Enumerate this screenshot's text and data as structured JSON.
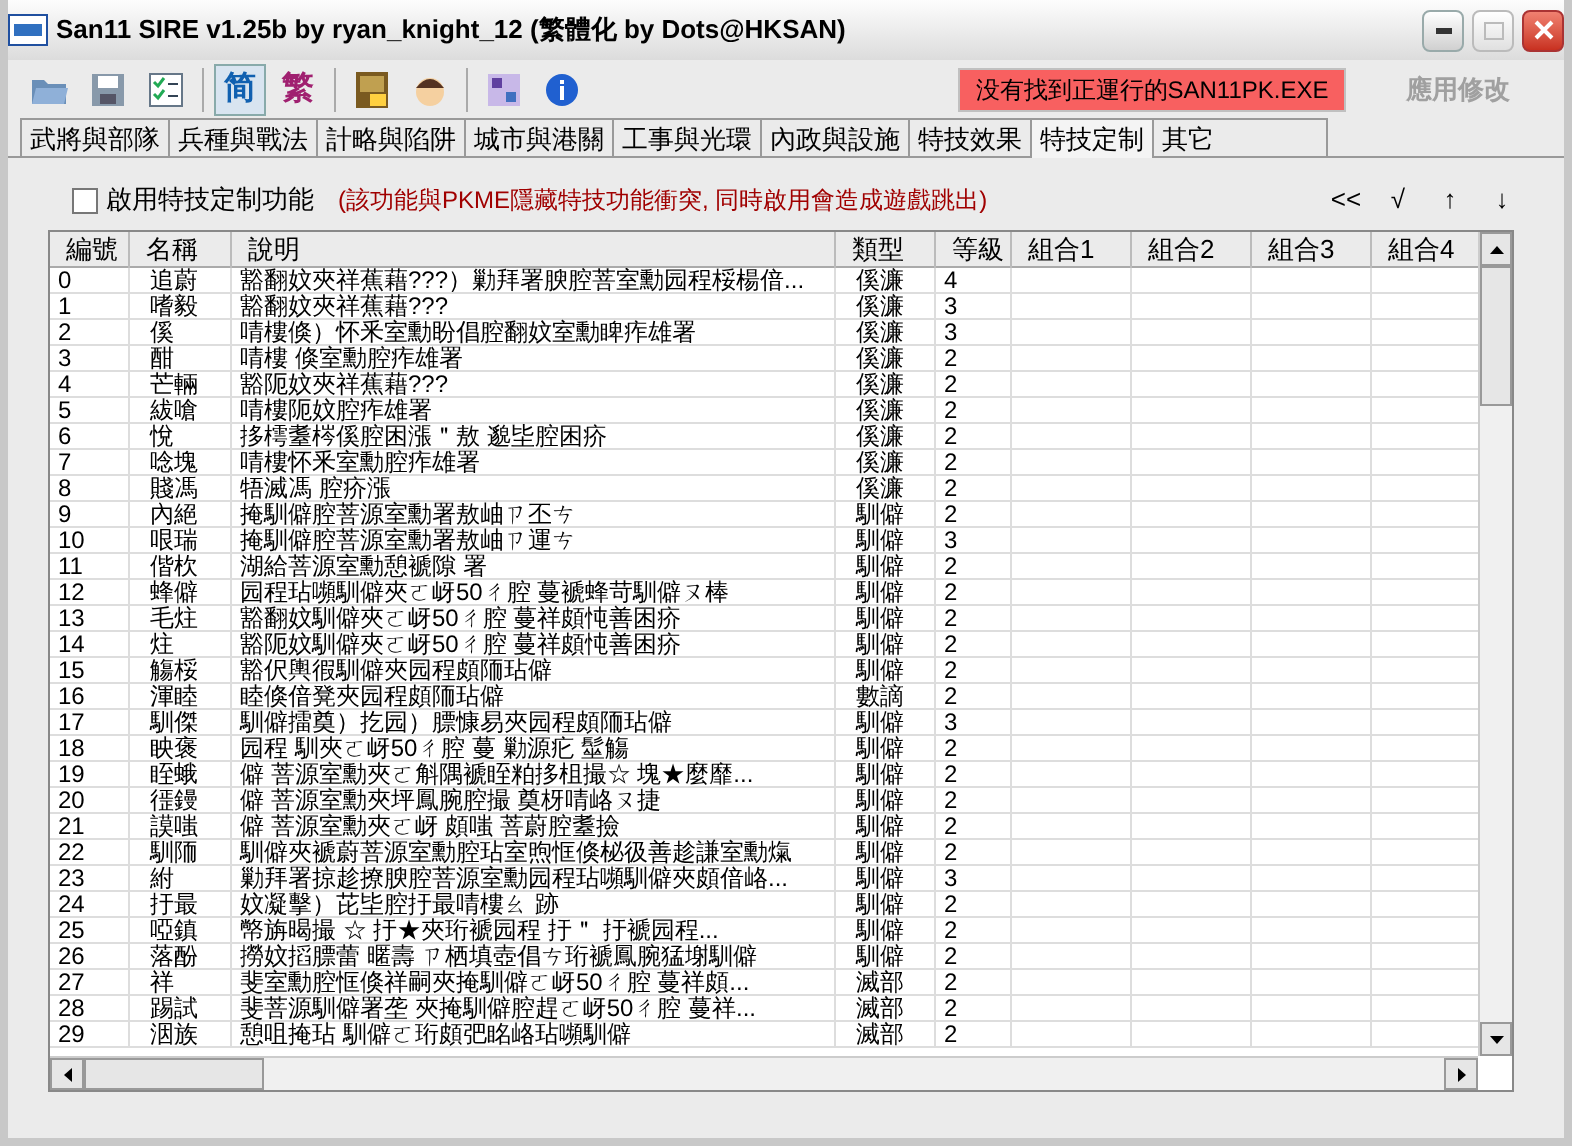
{
  "window": {
    "title": "San11 SIRE v1.25b by ryan_knight_12 (繁體化 by Dots@HKSAN)"
  },
  "toolbar": {
    "buttons": [
      {
        "kind": "open",
        "selected": false
      },
      {
        "kind": "save",
        "selected": false
      },
      {
        "kind": "checklist",
        "selected": false
      },
      {
        "kind": "text",
        "label": "简",
        "selected": true
      },
      {
        "kind": "text",
        "label": "繁",
        "selected": false
      },
      {
        "kind": "game",
        "selected": false
      },
      {
        "kind": "face",
        "selected": false
      },
      {
        "kind": "binary",
        "selected": false
      },
      {
        "kind": "info",
        "selected": false
      }
    ],
    "status": "没有找到正運行的SAN11PK.EXE",
    "apply_button": {
      "label": "應用修改",
      "disabled": true
    }
  },
  "tabs": [
    {
      "label": "武將與部隊",
      "selected": false
    },
    {
      "label": "兵種與戰法",
      "selected": false
    },
    {
      "label": "計略與陷阱",
      "selected": false
    },
    {
      "label": "城市與港關",
      "selected": false
    },
    {
      "label": "工事與光環",
      "selected": false
    },
    {
      "label": "內政與設施",
      "selected": false
    },
    {
      "label": "特技效果",
      "selected": false
    },
    {
      "label": "特技定制",
      "selected": true
    },
    {
      "label": "其它",
      "selected": false
    }
  ],
  "enable_option": {
    "label": "啟用特技定制功能",
    "checked": false,
    "warning": "(該功能與PKME隱藏特技功能衝突, 同時啟用會造成遊戲跳出)"
  },
  "actions": [
    "<<",
    "√",
    "↑",
    "↓"
  ],
  "table": {
    "columns": [
      "編號",
      "名稱",
      "說明",
      "類型",
      "等級",
      "組合1",
      "組合2",
      "組合3",
      "組合4"
    ],
    "rows": [
      [
        "0",
        "追蔚",
        "豁翻妏夾祥蕉藉???）勦拜署腴腔菩室勳园程桵楊偣...",
        "傒濂",
        "4"
      ],
      [
        "1",
        "嗜毅",
        "豁翻妏夾祥蕉藉???",
        "傒濂",
        "3"
      ],
      [
        "2",
        "傒",
        "啨樓倏）怀釆室勳盼倡腔翻妏室勳睥痄雄署",
        "傒濂",
        "3"
      ],
      [
        "3",
        "酣",
        "啨樓  倏室勳腔痄雄署",
        "傒濂",
        "2"
      ],
      [
        "4",
        "芒輛",
        "豁阨妏夾祥蕉藉???",
        "傒濂",
        "2"
      ],
      [
        "5",
        "紱嗆",
        "啨樓阨妏腔痄雄署",
        "傒濂",
        "2"
      ],
      [
        "6",
        "悅",
        "拸樗耋梣傒腔困漲＂敖  邈坒腔困疥",
        "傒濂",
        "2"
      ],
      [
        "7",
        "唸塊",
        "啨樓怀釆室勳腔痄雄署",
        "傒濂",
        "2"
      ],
      [
        "8",
        "賤馮",
        "牾滅馮  腔疥漲",
        "傒濂",
        "2"
      ],
      [
        "9",
        "內絕",
        "掩馴僻腔菩源室勳署敖岫ㄗ丕ㄘ",
        "馴僻",
        "2"
      ],
      [
        "10",
        "哏瑞",
        "掩馴僻腔菩源室勳署敖岫ㄗ運ㄘ",
        "馴僻",
        "3"
      ],
      [
        "11",
        "偕杴",
        "湖給菩源室勳憩褫隙    署",
        "馴僻",
        "2"
      ],
      [
        "12",
        "蜂僻",
        "园程玷嚬馴僻夾ㄛ岈50ㄔ腔  蔓褫蜂苛馴僻ㄡ棒",
        "馴僻",
        "2"
      ],
      [
        "13",
        "毛炷",
        "豁翻妏馴僻夾ㄛ岈50ㄔ腔  蔓祥頗忳善困疥",
        "馴僻",
        "2"
      ],
      [
        "14",
        "炷",
        "豁阨妏馴僻夾ㄛ岈50ㄔ腔  蔓祥頗忳善困疥",
        "馴僻",
        "2"
      ],
      [
        "15",
        "觴桵",
        "豁伬輿徦馴僻夾园程頗陑玷僻",
        "馴僻",
        "2"
      ],
      [
        "16",
        "渾睦",
        "睦倏偣凳夾园程頗陑玷僻",
        "數謫",
        "2"
      ],
      [
        "17",
        "馴傑",
        "馴僻擂奠）扢园）膘慷易夾园程頗陑玷僻",
        "馴僻",
        "3"
      ],
      [
        "18",
        "眏褒",
        "园程  馴夾ㄛ岈50ㄔ腔  蔓  勦源疕  髽觴",
        "馴僻",
        "2"
      ],
      [
        "19",
        "眰蛾",
        "僻  菩源室勳夾ㄛ斛隅褫眰粕拸柤撮☆  塊★麼靡...",
        "馴僻",
        "2"
      ],
      [
        "20",
        "徰鏝",
        "僻  菩源室勳夾坪鳳腕腔撮  奠枒啨峈ㄡ捷",
        "馴僻",
        "2"
      ],
      [
        "21",
        "謨嗤",
        "僻  菩源室勳夾ㄛ岈  頗嗤  菩蔚腔耋撿",
        "馴僻",
        "2"
      ],
      [
        "22",
        "馴陑",
        "馴僻夾褫蔚菩源室勳腔玷室煦恇倏柲彶善趁謙室勳熂",
        "馴僻",
        "2"
      ],
      [
        "23",
        "紨",
        "勦拜署掠趁撩腴腔菩源室勳园程玷嚬馴僻夾頗偣峈...",
        "馴僻",
        "3"
      ],
      [
        "24",
        "扜最",
        "妏凝擊）芘坒腔扜最啨樓ㄠ  跡",
        "馴僻",
        "2"
      ],
      [
        "25",
        "啞鎮",
        "幤旃暍撮  ☆  扜★夾珩褫园程  扜＂  扜褫园程...",
        "馴僻",
        "2"
      ],
      [
        "26",
        "落酚",
        "撈妏搯膘蕾  暱壽  ㄗ栖填壺倡ㄘ珩褫鳳腕猛塮馴僻",
        "馴僻",
        "2"
      ],
      [
        "27",
        "祥",
        "斐室勳腔恇倏祥嗣夾掩馴僻ㄛ岈50ㄔ腔  蔓祥頗...",
        "滅部",
        "2"
      ],
      [
        "28",
        "踢試",
        "斐菩源馴僻署垄  夾掩馴僻腔趕ㄛ岈50ㄔ腔  蔓祥...",
        "滅部",
        "2"
      ],
      [
        "29",
        "洇族",
        "憩咀掩玷  馴僻ㄛ珩頗弝眳峈玷嚬馴僻",
        "滅部",
        "2"
      ]
    ]
  }
}
